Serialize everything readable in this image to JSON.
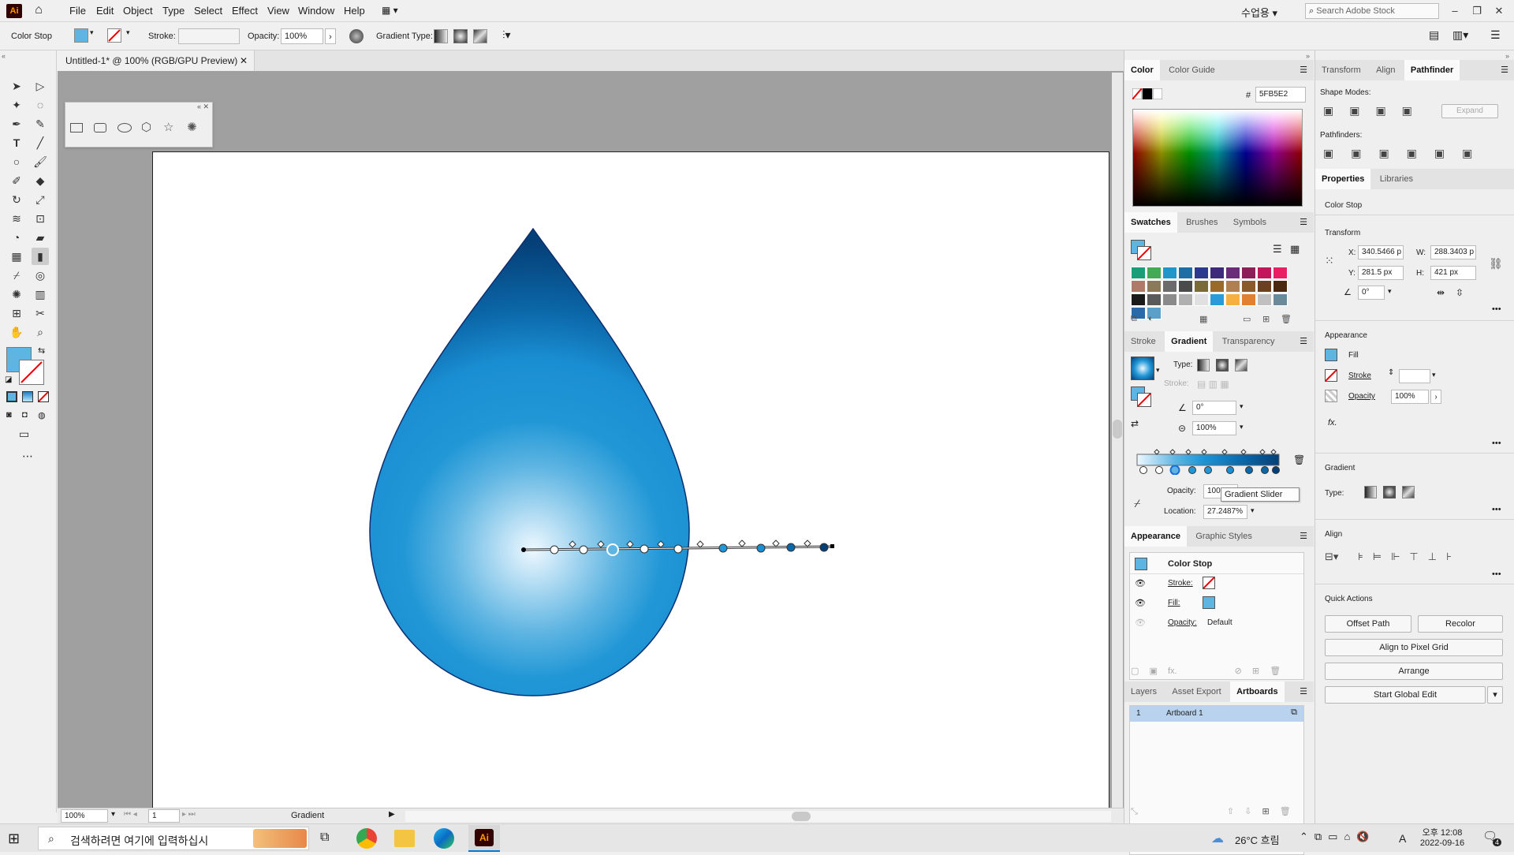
{
  "app": {
    "logo": "Ai",
    "search_placeholder": "Search Adobe Stock",
    "workspace": "수업용"
  },
  "menu": [
    "File",
    "Edit",
    "Object",
    "Type",
    "Select",
    "Effect",
    "View",
    "Window",
    "Help"
  ],
  "control": {
    "context": "Color Stop",
    "stroke_label": "Stroke:",
    "opacity_label": "Opacity:",
    "opacity_value": "100%",
    "gradient_type_label": "Gradient Type:"
  },
  "document": {
    "tab_title": "Untitled-1* @ 100% (RGB/GPU Preview)"
  },
  "status": {
    "zoom": "100%",
    "artboard_num": "1",
    "tool_name": "Gradient"
  },
  "color_panel": {
    "tabs": [
      "Color",
      "Color Guide"
    ],
    "hex_label": "#",
    "hex_value": "5FB5E2"
  },
  "swatches_panel": {
    "tabs": [
      "Swatches",
      "Brushes",
      "Symbols"
    ],
    "colors": [
      "#1b9e77",
      "#44aa55",
      "#2196c8",
      "#1c6ea4",
      "#2b3a8c",
      "#3d2a7a",
      "#6a2b7a",
      "#8c1e5a",
      "#c2185b",
      "#e91e63",
      "#b07a6a",
      "#8a7a5a",
      "#6b6b6b",
      "#4a4a4a",
      "#7a6a3a",
      "#9a6a2a",
      "#b08050",
      "#8a5a2a",
      "#6a4020",
      "#4a2810",
      "#1a1a1a",
      "#5a5a5a",
      "#8a8a8a",
      "#b0b0b0",
      "#e0e0e0",
      "#2a9ad8",
      "#f5b040",
      "#e08030",
      "#c0c0c0",
      "#6a8a9a",
      "#2a6aa8",
      "#5aa0c8"
    ]
  },
  "gradient_panel": {
    "tabs": [
      "Stroke",
      "Gradient",
      "Transparency"
    ],
    "type_label": "Type:",
    "stroke_label": "Stroke:",
    "angle_value": "0°",
    "aspect_value": "100%",
    "opacity_label": "Opacity:",
    "opacity_value": "100%",
    "location_label": "Location:",
    "location_value": "27.2487%",
    "tooltip": "Gradient Slider"
  },
  "appearance_panel": {
    "tabs": [
      "Appearance",
      "Graphic Styles"
    ],
    "title": "Color Stop",
    "stroke_label": "Stroke:",
    "fill_label": "Fill:",
    "opacity_label": "Opacity:",
    "opacity_value": "Default"
  },
  "layers_panel": {
    "tabs": [
      "Layers",
      "Asset Export",
      "Artboards"
    ],
    "artboard_num": "1",
    "artboard_name": "Artboard 1"
  },
  "right_panel": {
    "tabs": [
      "Transform",
      "Align",
      "Pathfinder"
    ],
    "shape_modes": "Shape Modes:",
    "expand": "Expand",
    "pathfinders": "Pathfinders:"
  },
  "properties": {
    "tabs": [
      "Properties",
      "Libraries"
    ],
    "context": "Color Stop",
    "transform_title": "Transform",
    "x_label": "X:",
    "x_value": "340.5466 p",
    "w_label": "W:",
    "w_value": "288.3403 p",
    "y_label": "Y:",
    "y_value": "281.5 px",
    "h_label": "H:",
    "h_value": "421 px",
    "rotate_value": "0°",
    "appearance_title": "Appearance",
    "fill_label": "Fill",
    "stroke_label": "Stroke",
    "opacity_label": "Opacity",
    "opacity_value": "100%",
    "fx": "fx.",
    "gradient_title": "Gradient",
    "type_label": "Type:",
    "align_title": "Align",
    "quick_actions": "Quick Actions",
    "offset_path": "Offset Path",
    "recolor": "Recolor",
    "align_pixel": "Align to Pixel Grid",
    "arrange": "Arrange",
    "start_global": "Start Global Edit"
  },
  "taskbar": {
    "search_placeholder": "검색하려면 여기에 입력하십시",
    "weather": "26°C 흐림",
    "time_period": "오후 12:08",
    "date": "2022-09-16",
    "lang": "A",
    "notification_count": "4"
  }
}
